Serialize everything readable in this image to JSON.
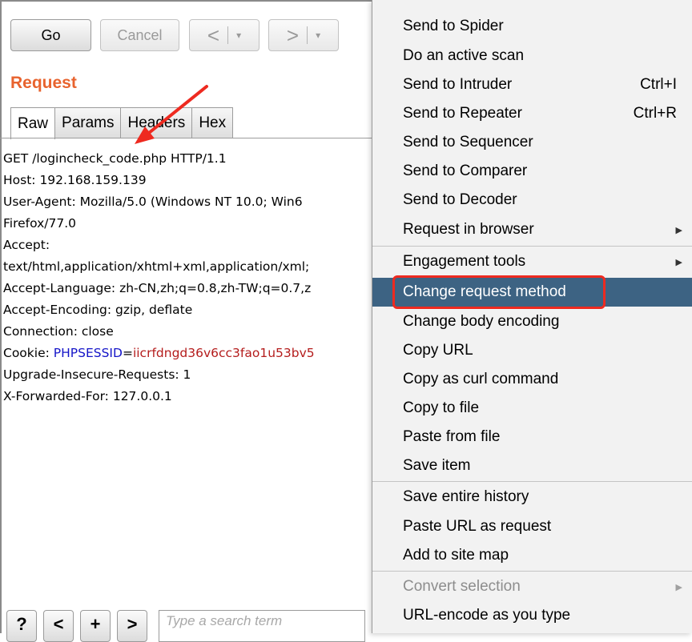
{
  "toolbar": {
    "go_label": "Go",
    "cancel_label": "Cancel",
    "back_label": "<",
    "forward_label": ">",
    "dropdown_glyph": "▾"
  },
  "request": {
    "title": "Request",
    "tabs": [
      {
        "label": "Raw",
        "active": true
      },
      {
        "label": "Params",
        "active": false
      },
      {
        "label": "Headers",
        "active": false
      },
      {
        "label": "Hex",
        "active": false
      }
    ],
    "lines": [
      "GET /logincheck_code.php HTTP/1.1",
      "Host: 192.168.159.139",
      "User-Agent: Mozilla/5.0 (Windows NT 10.0; Win6",
      "Firefox/77.0",
      "Accept:",
      "text/html,application/xhtml+xml,application/xml;",
      "Accept-Language: zh-CN,zh;q=0.8,zh-TW;q=0.7,z",
      "Accept-Encoding: gzip, deflate",
      "Connection: close",
      "Upgrade-Insecure-Requests: 1",
      "X-Forwarded-For: 127.0.0.1"
    ],
    "cookie": {
      "prefix": "Cookie: ",
      "name": "PHPSESSID",
      "eq": "=",
      "value": "iicrfdngd36v6cc3fao1u53bv5"
    }
  },
  "search_bar": {
    "help_label": "?",
    "prev_label": "<",
    "add_label": "+",
    "next_label": ">",
    "placeholder": "Type a search term"
  },
  "context_menu": {
    "items": [
      {
        "label": "Send to Spider"
      },
      {
        "label": "Do an active scan"
      },
      {
        "label": "Send to Intruder",
        "shortcut": "Ctrl+I"
      },
      {
        "label": "Send to Repeater",
        "shortcut": "Ctrl+R"
      },
      {
        "label": "Send to Sequencer"
      },
      {
        "label": "Send to Comparer"
      },
      {
        "label": "Send to Decoder"
      },
      {
        "label": "Request in browser",
        "submenu": true
      },
      {
        "label": "Engagement tools",
        "submenu": true
      },
      {
        "label": "Change request method",
        "highlighted": true
      },
      {
        "label": "Change body encoding"
      },
      {
        "label": "Copy URL"
      },
      {
        "label": "Copy as curl command"
      },
      {
        "label": "Copy to file"
      },
      {
        "label": "Paste from file"
      },
      {
        "label": "Save item"
      },
      {
        "label": "Save entire history"
      },
      {
        "label": "Paste URL as request"
      },
      {
        "label": "Add to site map"
      },
      {
        "label": "Convert selection",
        "submenu": true,
        "disabled": true
      },
      {
        "label": "URL-encode as you type"
      }
    ],
    "submenu_glyph": "▶"
  },
  "colors": {
    "accent_orange": "#e8632e",
    "menu_highlight": "#3d6383",
    "annotation_red": "#ee2a20",
    "cookie_name_blue": "#1515c8",
    "cookie_value_red": "#b41c1c"
  }
}
